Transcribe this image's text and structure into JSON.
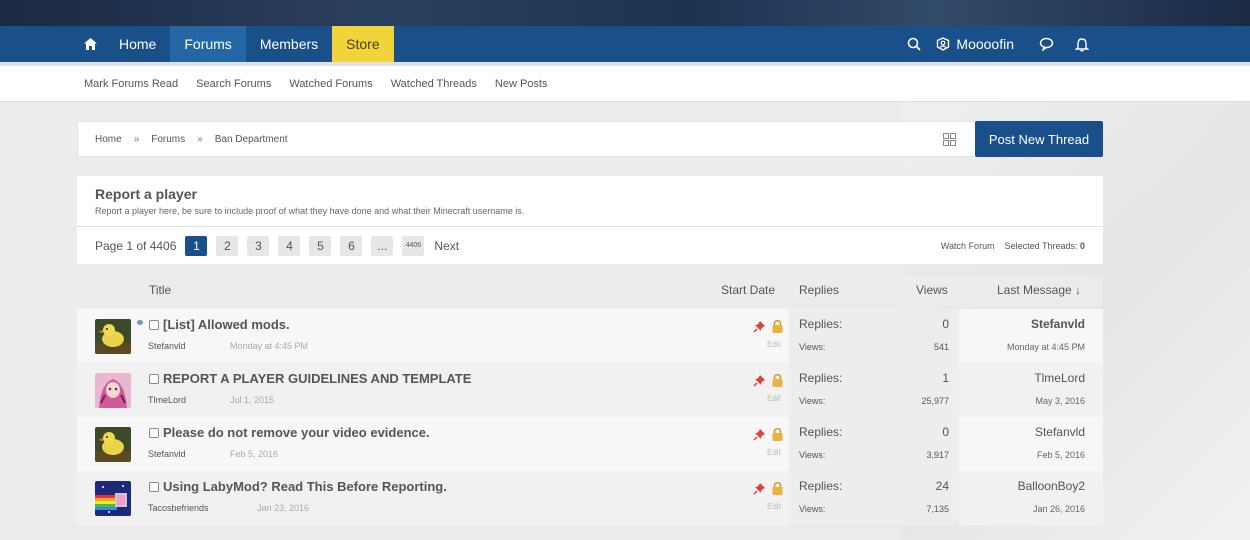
{
  "colors": {
    "nav_bg": "#195089",
    "nav_active": "#2467a5",
    "store_bg": "#f0d43a",
    "button_bg": "#195089"
  },
  "nav": {
    "home_icon": "home-icon",
    "tabs": [
      {
        "label": "Home"
      },
      {
        "label": "Forums"
      },
      {
        "label": "Members"
      },
      {
        "label": "Store"
      }
    ],
    "username": "Moooofin",
    "icons": [
      "search-icon",
      "user-shield-icon",
      "chat-bubble-icon",
      "bell-icon"
    ]
  },
  "subnav": {
    "links": [
      "Mark Forums Read",
      "Search Forums",
      "Watched Forums",
      "Watched Threads",
      "New Posts"
    ]
  },
  "breadcrumb": {
    "items": [
      "Home",
      "Forums",
      "Ban Department"
    ],
    "separator": "»",
    "post_button": "Post New Thread"
  },
  "forum": {
    "title": "Report a player",
    "description": "Report a player here, be sure to include proof of what they have done and what their Minecraft username is."
  },
  "pager": {
    "label": "Page 1 of 4406",
    "pages": [
      "1",
      "2",
      "3",
      "4",
      "5",
      "6",
      "...",
      "4406"
    ],
    "current": "1",
    "next": "Next",
    "watch_forum": "Watch Forum",
    "selected_threads_label": "Selected Threads:",
    "selected_threads_count": "0"
  },
  "columns": {
    "title": "Title",
    "start_date": "Start Date",
    "replies": "Replies",
    "views": "Views",
    "last_message": "Last Message ↓"
  },
  "threads": [
    {
      "title": "[List] Allowed mods.",
      "author": "Stefanvld",
      "date": "Monday at 4:45 PM",
      "edit": "Edit",
      "replies_label": "Replies:",
      "replies": "0",
      "views_label": "Views:",
      "views": "541",
      "last_user": "Stefanvld",
      "last_date": "Monday at 4:45 PM"
    },
    {
      "title": "REPORT A PLAYER GUIDELINES AND TEMPLATE",
      "author": "TlmeLord",
      "date": "Jul 1, 2015",
      "edit": "Edit",
      "replies_label": "Replies:",
      "replies": "1",
      "views_label": "Views:",
      "views": "25,977",
      "last_user": "TlmeLord",
      "last_date": "May 3, 2016"
    },
    {
      "title": "Please do not remove your video evidence.",
      "author": "Stefanvld",
      "date": "Feb 5, 2016",
      "edit": "Edit",
      "replies_label": "Replies:",
      "replies": "0",
      "views_label": "Views:",
      "views": "3,917",
      "last_user": "Stefanvld",
      "last_date": "Feb 5, 2016"
    },
    {
      "title": "Using LabyMod? Read This Before Reporting.",
      "author": "Tacosbefriends",
      "date": "Jan 23, 2016",
      "edit": "Edit",
      "replies_label": "Replies:",
      "replies": "24",
      "views_label": "Views:",
      "views": "7,135",
      "last_user": "BalloonBoy2",
      "last_date": "Jan 26, 2016"
    }
  ]
}
